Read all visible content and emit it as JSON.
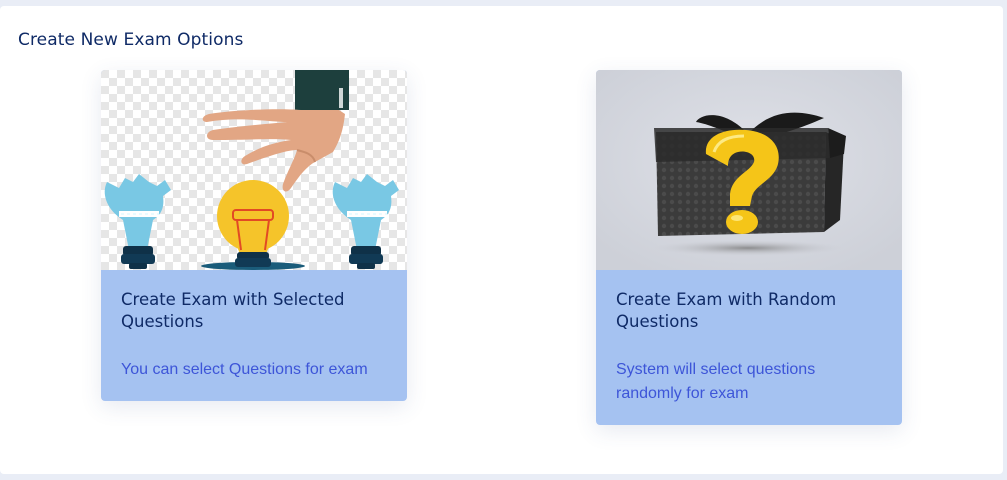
{
  "page": {
    "title": "Create New Exam Options"
  },
  "options": [
    {
      "title": "Create Exam with Selected Questions",
      "description": "You can select Questions for exam",
      "image_icon": "hand-picking-lightbulb-icon"
    },
    {
      "title": "Create Exam with Random Questions",
      "description": "System will select questions randomly for exam",
      "image_icon": "mystery-gift-box-icon"
    }
  ],
  "colors": {
    "background": "#e9edf6",
    "panel": "#ffffff",
    "card_body": "#a5c2f1",
    "title_text": "#0f2a66",
    "description_text": "#3d55d8"
  }
}
